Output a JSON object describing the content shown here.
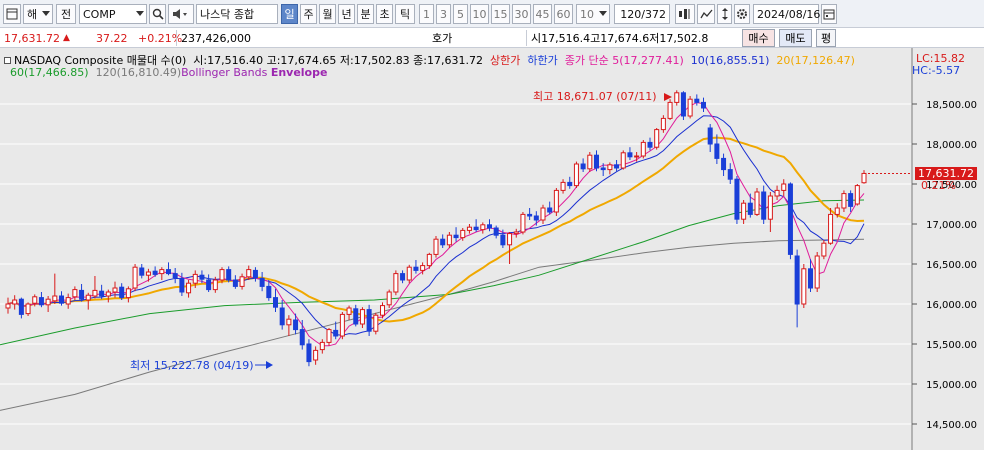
{
  "toolbar": {
    "market_select": "해",
    "jeon_label": "전",
    "symbol_value": "COMP",
    "index_name": "나스닥 종합",
    "periods": [
      "일",
      "주",
      "월",
      "년",
      "분",
      "초",
      "틱"
    ],
    "active_period": "일",
    "intervals": [
      "1",
      "3",
      "5",
      "10",
      "15",
      "30",
      "45",
      "60"
    ],
    "interval_select": "10",
    "count_display": "120/372",
    "date_value": "2024/08/16"
  },
  "info": {
    "price": "17,631.72",
    "change": "37.22",
    "change_pct": "+0.21%",
    "volume": "237,426,000",
    "hoga_label": "호가",
    "ohl_text": "시17,516.4고17,674.6저17,502.8",
    "buy_label": "매수",
    "sell_label": "매도",
    "eval_label": "평"
  },
  "legend": {
    "series_title": "NASDAQ Composite 매물대 수(0)",
    "ohlc": "시:17,516.40 고:17,674.65 저:17,502.83 종:17,631.72",
    "upper_limit": "상한가",
    "lower_limit": "하한가",
    "ma_label": "종가 단순 5(17,277.41)",
    "ma10": "10(16,855.51)",
    "ma20": "20(17,126.47)",
    "ma60": "60(17,466.85)",
    "ma120": "120(16,810.49)",
    "bollinger": "Bollinger Bands",
    "envelope": "Envelope",
    "lc": "LC:15.82",
    "hc": "HC:-5.57"
  },
  "annotations": {
    "high": "최고 18,671.07 (07/11)",
    "low": "최저 15,222.78 (04/19)",
    "current_price": "17,631.72",
    "current_pct": "0.21%"
  },
  "colors": {
    "up": "#d81a1a",
    "down": "#1a3fd8",
    "ma5": "#e01c9a",
    "ma10": "#1a2fd0",
    "ma20": "#f0a800",
    "ma60": "#1b9c2c",
    "ma120": "#7a7a7a"
  },
  "chart_data": {
    "type": "candlestick",
    "yticks": [
      "18,500.00",
      "18,000.00",
      "17,500.00",
      "17,000.00",
      "16,500.00",
      "16,000.00",
      "15,500.00",
      "15,000.00",
      "14,500.00"
    ],
    "ylim": [
      14300,
      19000
    ],
    "candles": [
      [
        15950,
        16080,
        15880,
        16000
      ],
      [
        16000,
        16110,
        15930,
        16050
      ],
      [
        16060,
        16080,
        15820,
        15870
      ],
      [
        15880,
        16020,
        15850,
        16000
      ],
      [
        16010,
        16120,
        15970,
        16090
      ],
      [
        16080,
        16150,
        15960,
        15990
      ],
      [
        15990,
        16100,
        15900,
        16060
      ],
      [
        16040,
        16380,
        16000,
        16100
      ],
      [
        16100,
        16160,
        15980,
        16010
      ],
      [
        16000,
        16130,
        15940,
        16080
      ],
      [
        16090,
        16220,
        16050,
        16180
      ],
      [
        16170,
        16250,
        16030,
        16060
      ],
      [
        16050,
        16140,
        15930,
        16110
      ],
      [
        16100,
        16350,
        16070,
        16170
      ],
      [
        16160,
        16240,
        16060,
        16100
      ],
      [
        16100,
        16180,
        16020,
        16150
      ],
      [
        16150,
        16280,
        16080,
        16200
      ],
      [
        16210,
        16260,
        16050,
        16080
      ],
      [
        16080,
        16220,
        16020,
        16190
      ],
      [
        16200,
        16500,
        16160,
        16460
      ],
      [
        16450,
        16500,
        16320,
        16360
      ],
      [
        16360,
        16440,
        16280,
        16400
      ],
      [
        16410,
        16470,
        16340,
        16370
      ],
      [
        16380,
        16460,
        16300,
        16430
      ],
      [
        16430,
        16520,
        16360,
        16380
      ],
      [
        16380,
        16450,
        16260,
        16330
      ],
      [
        16320,
        16390,
        16100,
        16150
      ],
      [
        16140,
        16300,
        16080,
        16260
      ],
      [
        16260,
        16420,
        16200,
        16370
      ],
      [
        16360,
        16420,
        16260,
        16310
      ],
      [
        16300,
        16370,
        16150,
        16180
      ],
      [
        16180,
        16340,
        16140,
        16300
      ],
      [
        16300,
        16460,
        16260,
        16430
      ],
      [
        16430,
        16470,
        16270,
        16300
      ],
      [
        16300,
        16360,
        16190,
        16220
      ],
      [
        16220,
        16380,
        16180,
        16340
      ],
      [
        16340,
        16480,
        16300,
        16430
      ],
      [
        16420,
        16460,
        16280,
        16330
      ],
      [
        16320,
        16400,
        16160,
        16220
      ],
      [
        16220,
        16300,
        16040,
        16080
      ],
      [
        16080,
        16190,
        15900,
        15960
      ],
      [
        15950,
        16050,
        15680,
        15740
      ],
      [
        15740,
        15860,
        15600,
        15810
      ],
      [
        15800,
        15880,
        15620,
        15680
      ],
      [
        15680,
        15800,
        15430,
        15490
      ],
      [
        15500,
        15560,
        15222,
        15280
      ],
      [
        15300,
        15470,
        15240,
        15420
      ],
      [
        15430,
        15560,
        15380,
        15520
      ],
      [
        15520,
        15700,
        15480,
        15680
      ],
      [
        15670,
        15780,
        15560,
        15600
      ],
      [
        15600,
        15900,
        15560,
        15870
      ],
      [
        15870,
        15980,
        15800,
        15950
      ],
      [
        15940,
        15990,
        15720,
        15750
      ],
      [
        15750,
        15960,
        15700,
        15930
      ],
      [
        15930,
        15990,
        15600,
        15660
      ],
      [
        15660,
        15890,
        15620,
        15860
      ],
      [
        15860,
        16020,
        15820,
        15980
      ],
      [
        15990,
        16180,
        15950,
        16150
      ],
      [
        16150,
        16420,
        16110,
        16380
      ],
      [
        16380,
        16420,
        16260,
        16300
      ],
      [
        16300,
        16490,
        16260,
        16460
      ],
      [
        16460,
        16550,
        16380,
        16420
      ],
      [
        16420,
        16520,
        16370,
        16480
      ],
      [
        16480,
        16640,
        16440,
        16620
      ],
      [
        16620,
        16850,
        16580,
        16810
      ],
      [
        16810,
        16870,
        16700,
        16740
      ],
      [
        16740,
        16900,
        16700,
        16860
      ],
      [
        16860,
        16960,
        16780,
        16830
      ],
      [
        16830,
        16950,
        16790,
        16920
      ],
      [
        16920,
        17000,
        16880,
        16960
      ],
      [
        16960,
        17060,
        16900,
        16930
      ],
      [
        16930,
        17020,
        16880,
        16990
      ],
      [
        16990,
        17060,
        16910,
        16950
      ],
      [
        16950,
        16980,
        16820,
        16860
      ],
      [
        16860,
        16930,
        16700,
        16740
      ],
      [
        16740,
        16900,
        16500,
        16880
      ],
      [
        16880,
        16940,
        16830,
        16900
      ],
      [
        16900,
        17150,
        16870,
        17120
      ],
      [
        17120,
        17200,
        17050,
        17100
      ],
      [
        17100,
        17160,
        16980,
        17050
      ],
      [
        17050,
        17240,
        17000,
        17200
      ],
      [
        17200,
        17280,
        17120,
        17150
      ],
      [
        17150,
        17450,
        17100,
        17420
      ],
      [
        17420,
        17560,
        17380,
        17520
      ],
      [
        17520,
        17590,
        17440,
        17480
      ],
      [
        17480,
        17780,
        17450,
        17750
      ],
      [
        17750,
        17820,
        17650,
        17690
      ],
      [
        17690,
        17900,
        17650,
        17860
      ],
      [
        17860,
        17920,
        17660,
        17700
      ],
      [
        17700,
        17760,
        17600,
        17680
      ],
      [
        17680,
        17770,
        17620,
        17740
      ],
      [
        17740,
        17800,
        17660,
        17700
      ],
      [
        17700,
        17920,
        17680,
        17890
      ],
      [
        17890,
        17960,
        17800,
        17840
      ],
      [
        17840,
        17900,
        17780,
        17850
      ],
      [
        17850,
        18050,
        17820,
        18020
      ],
      [
        18020,
        18080,
        17920,
        17960
      ],
      [
        17960,
        18200,
        17930,
        18180
      ],
      [
        18180,
        18360,
        18140,
        18320
      ],
      [
        18320,
        18560,
        18300,
        18520
      ],
      [
        18520,
        18671,
        18480,
        18640
      ],
      [
        18640,
        18660,
        18300,
        18350
      ],
      [
        18350,
        18600,
        18320,
        18560
      ],
      [
        18560,
        18620,
        18480,
        18520
      ],
      [
        18520,
        18580,
        18400,
        18450
      ],
      [
        18200,
        18250,
        17900,
        18000
      ],
      [
        18000,
        18120,
        17750,
        17820
      ],
      [
        17820,
        17880,
        17600,
        17680
      ],
      [
        17680,
        17760,
        17500,
        17560
      ],
      [
        17560,
        17600,
        17000,
        17060
      ],
      [
        17060,
        17300,
        17000,
        17260
      ],
      [
        17260,
        17380,
        17080,
        17120
      ],
      [
        17120,
        17450,
        17100,
        17400
      ],
      [
        17400,
        17480,
        17000,
        17060
      ],
      [
        17060,
        17400,
        16900,
        17350
      ],
      [
        17350,
        17480,
        17300,
        17420
      ],
      [
        17420,
        17560,
        17350,
        17500
      ],
      [
        17500,
        17520,
        16560,
        16620
      ],
      [
        16600,
        16680,
        15708,
        16000
      ],
      [
        16000,
        16500,
        15950,
        16440
      ],
      [
        16440,
        16560,
        16150,
        16200
      ],
      [
        16200,
        16650,
        16150,
        16600
      ],
      [
        16600,
        16800,
        16560,
        16760
      ],
      [
        16760,
        17200,
        16740,
        17120
      ],
      [
        17120,
        17260,
        17080,
        17200
      ],
      [
        17200,
        17420,
        17150,
        17380
      ],
      [
        17380,
        17420,
        17150,
        17220
      ],
      [
        17250,
        17500,
        17230,
        17480
      ],
      [
        17516,
        17674,
        17503,
        17632
      ]
    ],
    "ma120_path": [
      [
        0,
        14670
      ],
      [
        50,
        14870
      ],
      [
        100,
        15150
      ],
      [
        150,
        15400
      ],
      [
        200,
        15640
      ],
      [
        250,
        15880
      ],
      [
        300,
        16120
      ],
      [
        330,
        16280
      ],
      [
        360,
        16460
      ],
      [
        400,
        16560
      ],
      [
        430,
        16640
      ],
      [
        460,
        16710
      ],
      [
        490,
        16760
      ],
      [
        520,
        16790
      ],
      [
        550,
        16800
      ],
      [
        577,
        16810
      ]
    ],
    "ma60_path": [
      [
        0,
        15490
      ],
      [
        50,
        15700
      ],
      [
        100,
        15880
      ],
      [
        150,
        15980
      ],
      [
        200,
        16020
      ],
      [
        250,
        16050
      ],
      [
        300,
        16120
      ],
      [
        330,
        16230
      ],
      [
        360,
        16360
      ],
      [
        400,
        16600
      ],
      [
        430,
        16780
      ],
      [
        460,
        16980
      ],
      [
        490,
        17130
      ],
      [
        520,
        17230
      ],
      [
        550,
        17290
      ],
      [
        577,
        17300
      ]
    ]
  }
}
